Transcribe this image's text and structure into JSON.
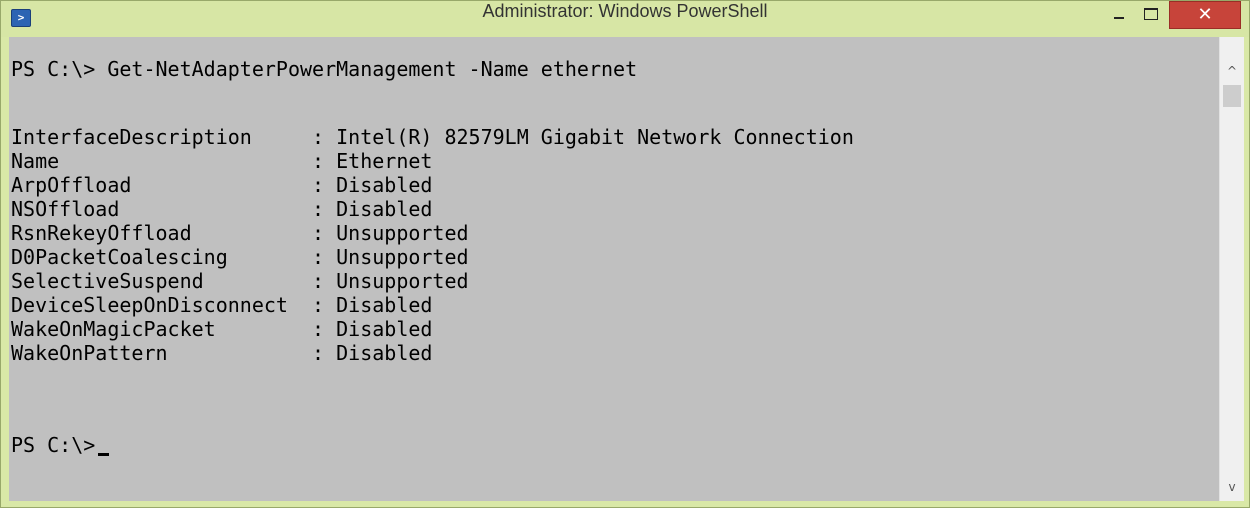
{
  "window": {
    "title": "Administrator: Windows PowerShell",
    "icon": "powershell-icon"
  },
  "controls": {
    "minimize_icon": "minimize-icon",
    "maximize_icon": "maximize-icon",
    "close_icon": "close-icon",
    "close_glyph": "✕",
    "close_color": "#c7443a"
  },
  "console": {
    "background": "#c0c0c0",
    "command": "PS C:\\> Get-NetAdapterPowerManagement -Name ethernet",
    "output": [
      "InterfaceDescription     : Intel(R) 82579LM Gigabit Network Connection",
      "Name                     : Ethernet",
      "ArpOffload               : Disabled",
      "NSOffload                : Disabled",
      "RsnRekeyOffload          : Unsupported",
      "D0PacketCoalescing       : Unsupported",
      "SelectiveSuspend         : Unsupported",
      "DeviceSleepOnDisconnect  : Disabled",
      "WakeOnMagicPacket        : Disabled",
      "WakeOnPattern            : Disabled"
    ],
    "prompt": "PS C:\\>"
  },
  "scrollbar": {
    "up_glyph": "^",
    "down_glyph": "v"
  }
}
